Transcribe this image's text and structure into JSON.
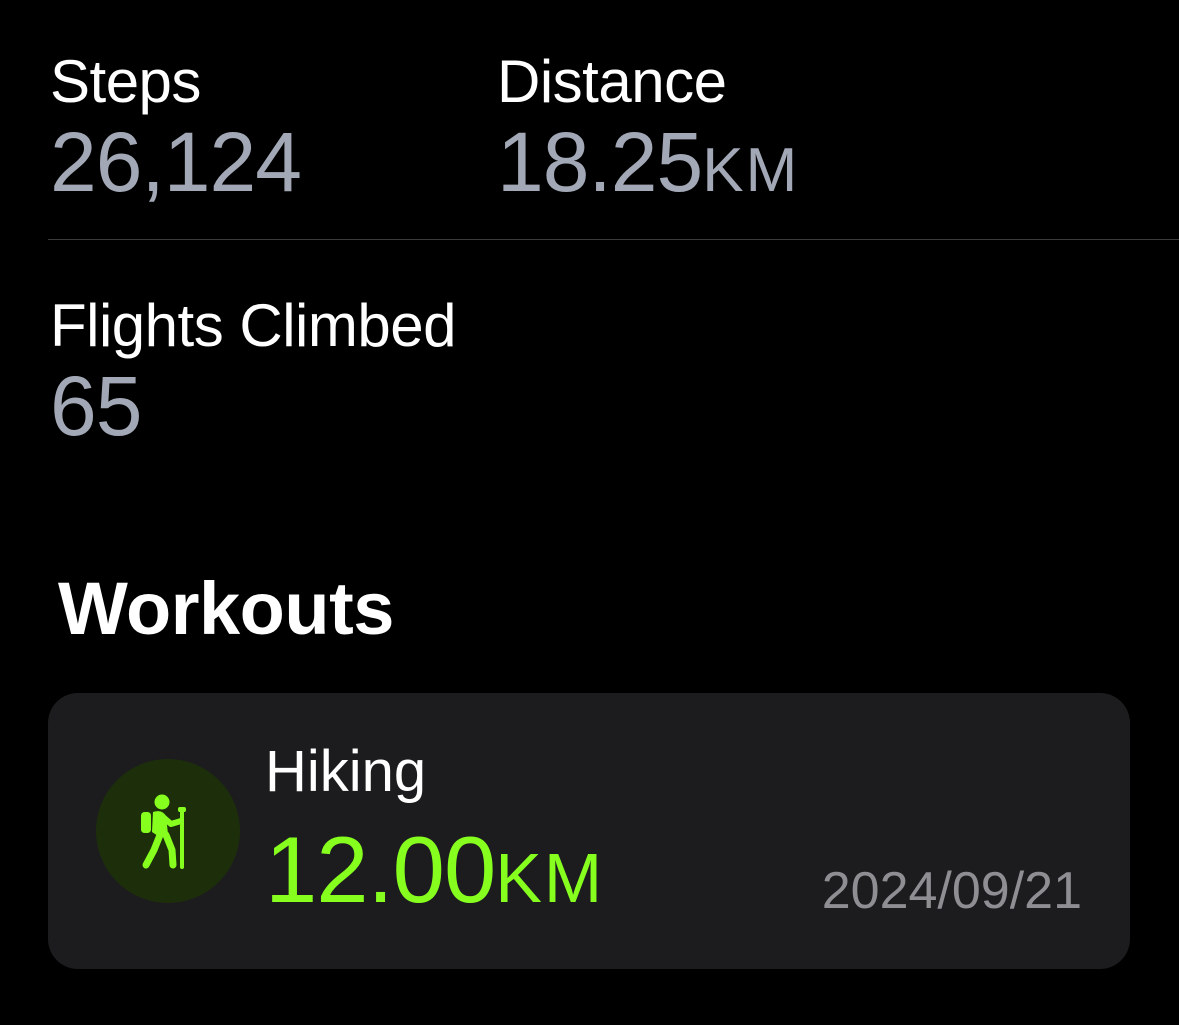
{
  "activity": {
    "steps": {
      "label": "Steps",
      "value": "26,124"
    },
    "distance": {
      "label": "Distance",
      "value": "18.25",
      "unit": "KM"
    },
    "flights": {
      "label": "Flights Climbed",
      "value": "65"
    }
  },
  "workouts": {
    "title": "Workouts",
    "items": [
      {
        "icon": "hiking-icon",
        "name": "Hiking",
        "distance": "12.00",
        "unit": "KM",
        "date": "2024/09/21",
        "accent_color": "#86ff1f"
      }
    ]
  },
  "colors": {
    "background": "#000000",
    "value_gray": "#a3a8b6",
    "card_background": "#1c1c1e",
    "workout_green": "#86ff1f"
  }
}
